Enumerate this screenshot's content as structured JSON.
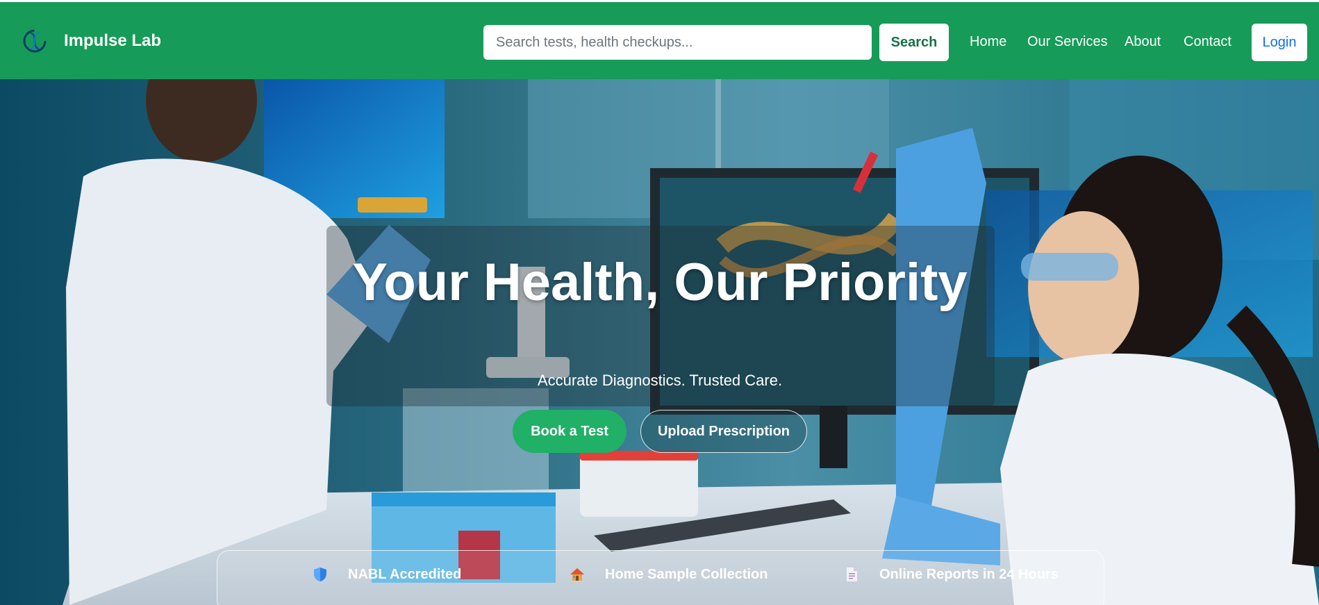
{
  "navbar": {
    "brand_name": "Impulse Lab",
    "logo_icon": "dna-logo-icon",
    "search": {
      "placeholder": "Search tests, health checkups...",
      "value": ""
    },
    "search_button": "Search",
    "links": [
      "Home",
      "Our Services",
      "About",
      "Contact"
    ],
    "login_button": "Login"
  },
  "hero": {
    "title": "Your Health, Our Priority",
    "subtitle": "Accurate Diagnostics. Trusted Care.",
    "primary_cta": "Book a Test",
    "secondary_cta": "Upload Prescription",
    "features": [
      {
        "icon": "shield-icon",
        "label": "NABL Accredited"
      },
      {
        "icon": "house-icon",
        "label": "Home Sample Collection"
      },
      {
        "icon": "document-icon",
        "label": "Online Reports in 24 Hours"
      }
    ]
  },
  "colors": {
    "navbar_green": "#169c58",
    "cta_green": "#20b066",
    "login_blue": "#0d6efd"
  }
}
